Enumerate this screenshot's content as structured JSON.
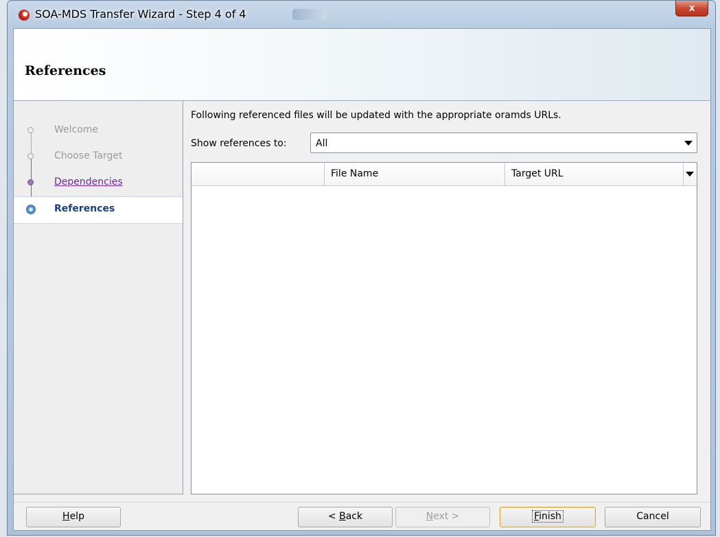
{
  "window": {
    "title": "SOA-MDS Transfer Wizard - Step 4 of 4",
    "close_label": "x"
  },
  "header": {
    "title": "References"
  },
  "nav": {
    "items": [
      {
        "label": "Welcome",
        "state": "disabled"
      },
      {
        "label": "Choose Target",
        "state": "disabled"
      },
      {
        "label": "Dependencies",
        "state": "visited"
      },
      {
        "label": "References",
        "state": "current"
      }
    ]
  },
  "content": {
    "description": "Following referenced files will be updated with the appropriate oramds URLs.",
    "show_label": "Show references to:",
    "show_value": "All",
    "table": {
      "columns": [
        "",
        "File Name",
        "Target URL"
      ],
      "rows": []
    }
  },
  "buttons": {
    "help": {
      "mnemonic": "H",
      "rest": "elp"
    },
    "back": {
      "prefix": "< ",
      "mnemonic": "B",
      "rest": "ack"
    },
    "next": {
      "mnemonic": "N",
      "rest": "ext >"
    },
    "finish": {
      "mnemonic": "F",
      "rest": "inish"
    },
    "cancel": "Cancel"
  },
  "colors": {
    "current_step": "#1a3f80",
    "visited_step": "#6a2a9a",
    "default_button_border": "#e0a030"
  }
}
